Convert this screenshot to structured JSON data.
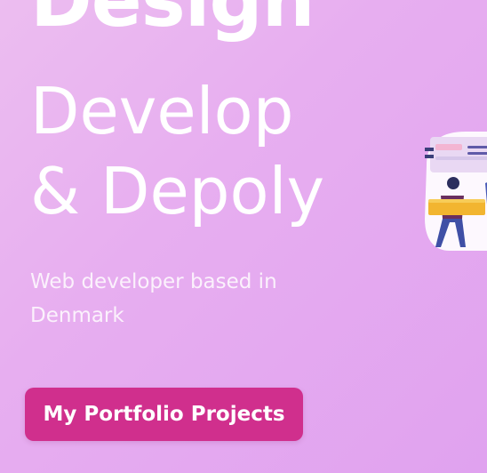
{
  "hero": {
    "design_word": "Design",
    "headline_line1": "Develop",
    "headline_line2": "& Depoly",
    "subtitle": "Web developer based in Denmark"
  },
  "cta": {
    "label": "My Portfolio Projects"
  },
  "colors": {
    "background_start": "#ecbdf0",
    "background_end": "#e0a2ef",
    "text": "#ffffff",
    "button": "#d02f8d"
  },
  "illustration": {
    "icon": "developer-illustration"
  }
}
